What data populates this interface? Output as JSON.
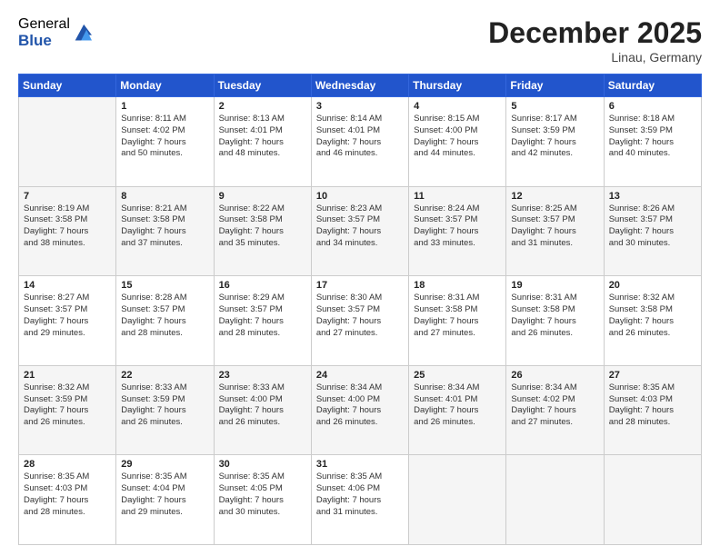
{
  "header": {
    "logo_general": "General",
    "logo_blue": "Blue",
    "month_title": "December 2025",
    "location": "Linau, Germany"
  },
  "days_of_week": [
    "Sunday",
    "Monday",
    "Tuesday",
    "Wednesday",
    "Thursday",
    "Friday",
    "Saturday"
  ],
  "weeks": [
    [
      {
        "day": "",
        "text": ""
      },
      {
        "day": "1",
        "text": "Sunrise: 8:11 AM\nSunset: 4:02 PM\nDaylight: 7 hours\nand 50 minutes."
      },
      {
        "day": "2",
        "text": "Sunrise: 8:13 AM\nSunset: 4:01 PM\nDaylight: 7 hours\nand 48 minutes."
      },
      {
        "day": "3",
        "text": "Sunrise: 8:14 AM\nSunset: 4:01 PM\nDaylight: 7 hours\nand 46 minutes."
      },
      {
        "day": "4",
        "text": "Sunrise: 8:15 AM\nSunset: 4:00 PM\nDaylight: 7 hours\nand 44 minutes."
      },
      {
        "day": "5",
        "text": "Sunrise: 8:17 AM\nSunset: 3:59 PM\nDaylight: 7 hours\nand 42 minutes."
      },
      {
        "day": "6",
        "text": "Sunrise: 8:18 AM\nSunset: 3:59 PM\nDaylight: 7 hours\nand 40 minutes."
      }
    ],
    [
      {
        "day": "7",
        "text": "Sunrise: 8:19 AM\nSunset: 3:58 PM\nDaylight: 7 hours\nand 38 minutes."
      },
      {
        "day": "8",
        "text": "Sunrise: 8:21 AM\nSunset: 3:58 PM\nDaylight: 7 hours\nand 37 minutes."
      },
      {
        "day": "9",
        "text": "Sunrise: 8:22 AM\nSunset: 3:58 PM\nDaylight: 7 hours\nand 35 minutes."
      },
      {
        "day": "10",
        "text": "Sunrise: 8:23 AM\nSunset: 3:57 PM\nDaylight: 7 hours\nand 34 minutes."
      },
      {
        "day": "11",
        "text": "Sunrise: 8:24 AM\nSunset: 3:57 PM\nDaylight: 7 hours\nand 33 minutes."
      },
      {
        "day": "12",
        "text": "Sunrise: 8:25 AM\nSunset: 3:57 PM\nDaylight: 7 hours\nand 31 minutes."
      },
      {
        "day": "13",
        "text": "Sunrise: 8:26 AM\nSunset: 3:57 PM\nDaylight: 7 hours\nand 30 minutes."
      }
    ],
    [
      {
        "day": "14",
        "text": "Sunrise: 8:27 AM\nSunset: 3:57 PM\nDaylight: 7 hours\nand 29 minutes."
      },
      {
        "day": "15",
        "text": "Sunrise: 8:28 AM\nSunset: 3:57 PM\nDaylight: 7 hours\nand 28 minutes."
      },
      {
        "day": "16",
        "text": "Sunrise: 8:29 AM\nSunset: 3:57 PM\nDaylight: 7 hours\nand 28 minutes."
      },
      {
        "day": "17",
        "text": "Sunrise: 8:30 AM\nSunset: 3:57 PM\nDaylight: 7 hours\nand 27 minutes."
      },
      {
        "day": "18",
        "text": "Sunrise: 8:31 AM\nSunset: 3:58 PM\nDaylight: 7 hours\nand 27 minutes."
      },
      {
        "day": "19",
        "text": "Sunrise: 8:31 AM\nSunset: 3:58 PM\nDaylight: 7 hours\nand 26 minutes."
      },
      {
        "day": "20",
        "text": "Sunrise: 8:32 AM\nSunset: 3:58 PM\nDaylight: 7 hours\nand 26 minutes."
      }
    ],
    [
      {
        "day": "21",
        "text": "Sunrise: 8:32 AM\nSunset: 3:59 PM\nDaylight: 7 hours\nand 26 minutes."
      },
      {
        "day": "22",
        "text": "Sunrise: 8:33 AM\nSunset: 3:59 PM\nDaylight: 7 hours\nand 26 minutes."
      },
      {
        "day": "23",
        "text": "Sunrise: 8:33 AM\nSunset: 4:00 PM\nDaylight: 7 hours\nand 26 minutes."
      },
      {
        "day": "24",
        "text": "Sunrise: 8:34 AM\nSunset: 4:00 PM\nDaylight: 7 hours\nand 26 minutes."
      },
      {
        "day": "25",
        "text": "Sunrise: 8:34 AM\nSunset: 4:01 PM\nDaylight: 7 hours\nand 26 minutes."
      },
      {
        "day": "26",
        "text": "Sunrise: 8:34 AM\nSunset: 4:02 PM\nDaylight: 7 hours\nand 27 minutes."
      },
      {
        "day": "27",
        "text": "Sunrise: 8:35 AM\nSunset: 4:03 PM\nDaylight: 7 hours\nand 28 minutes."
      }
    ],
    [
      {
        "day": "28",
        "text": "Sunrise: 8:35 AM\nSunset: 4:03 PM\nDaylight: 7 hours\nand 28 minutes."
      },
      {
        "day": "29",
        "text": "Sunrise: 8:35 AM\nSunset: 4:04 PM\nDaylight: 7 hours\nand 29 minutes."
      },
      {
        "day": "30",
        "text": "Sunrise: 8:35 AM\nSunset: 4:05 PM\nDaylight: 7 hours\nand 30 minutes."
      },
      {
        "day": "31",
        "text": "Sunrise: 8:35 AM\nSunset: 4:06 PM\nDaylight: 7 hours\nand 31 minutes."
      },
      {
        "day": "",
        "text": ""
      },
      {
        "day": "",
        "text": ""
      },
      {
        "day": "",
        "text": ""
      }
    ]
  ]
}
